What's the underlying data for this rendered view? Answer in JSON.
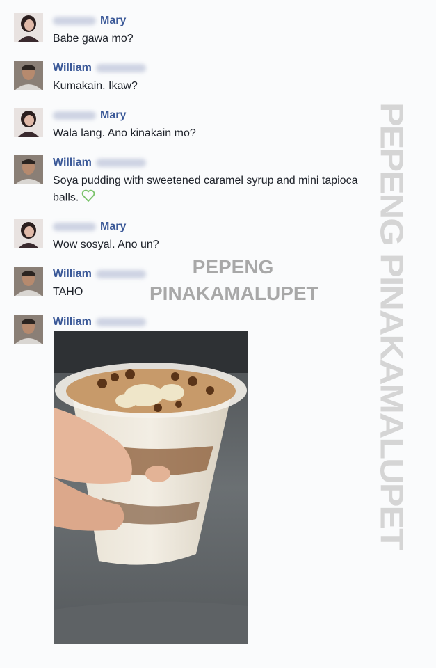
{
  "messages": [
    {
      "sender": "Mary",
      "text": "Babe gawa mo?"
    },
    {
      "sender": "William",
      "text": "Kumakain. Ikaw?"
    },
    {
      "sender": "Mary",
      "text": "Wala lang. Ano kinakain mo?"
    },
    {
      "sender": "William",
      "text": "Soya pudding with sweetened caramel syrup and mini tapioca balls."
    },
    {
      "sender": "Mary",
      "text": "Wow sosyal. Ano un?"
    },
    {
      "sender": "William",
      "text": "TAHO"
    },
    {
      "sender": "William",
      "text": ""
    }
  ],
  "watermark": {
    "vertical": "PEPENG PINAKAMALUPET",
    "center_line1": "PEPENG",
    "center_line2": "PINAKAMALUPET"
  },
  "icons": {
    "heart": "green-heart-icon"
  },
  "colors": {
    "name": "#3b5998",
    "text": "#1d2129",
    "heart": "#7ac36a"
  }
}
